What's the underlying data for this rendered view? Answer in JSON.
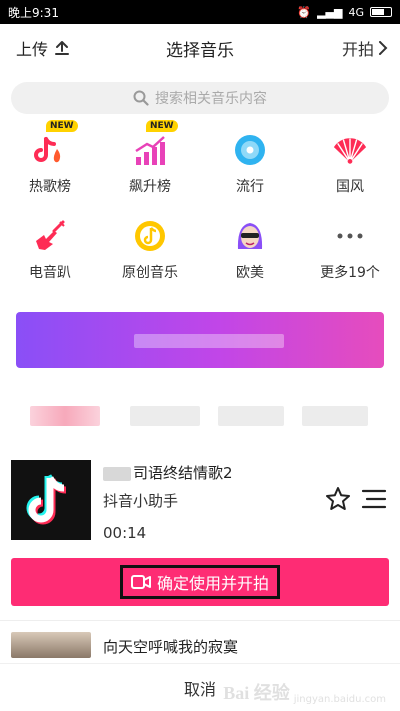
{
  "status_bar": {
    "time": "晚上9:31",
    "network": "4G",
    "signal": "信号",
    "alarm": "闹钟"
  },
  "header": {
    "upload_label": "上传",
    "title": "选择音乐",
    "start_label": "开拍"
  },
  "search": {
    "placeholder": "搜索相关音乐内容"
  },
  "categories": [
    {
      "label": "热歌榜",
      "badge": "NEW",
      "icon": "hot-chart-icon",
      "color": "#fe2c55"
    },
    {
      "label": "飙升榜",
      "badge": "NEW",
      "icon": "rising-chart-icon",
      "color": "#e842b8"
    },
    {
      "label": "流行",
      "badge": "",
      "icon": "disc-icon",
      "color": "#2fb3f0"
    },
    {
      "label": "国风",
      "badge": "",
      "icon": "fan-icon",
      "color": "#fe2c55"
    },
    {
      "label": "电音趴",
      "badge": "",
      "icon": "guitar-icon",
      "color": "#fe2c55"
    },
    {
      "label": "原创音乐",
      "badge": "",
      "icon": "music-note-icon",
      "color": "#ffc700"
    },
    {
      "label": "欧美",
      "badge": "",
      "icon": "avatar-sunglasses-icon",
      "color": "#8a4ff7"
    },
    {
      "label": "更多19个",
      "badge": "",
      "icon": "more-icon",
      "color": "#555555"
    }
  ],
  "track": {
    "name": "司语终结情歌2",
    "artist": "抖音小助手",
    "duration": "00:14"
  },
  "confirm": {
    "label": "确定使用并开拍"
  },
  "track2": {
    "name": "向天空呼喊我的寂寞"
  },
  "cancel": {
    "label": "取消"
  },
  "watermark": {
    "logo": "Bai 经验",
    "sub": "jingyan.baidu.com"
  },
  "colors": {
    "accent": "#fe2c74",
    "banner_start": "#8a4ff7",
    "banner_end": "#e64cbd"
  }
}
